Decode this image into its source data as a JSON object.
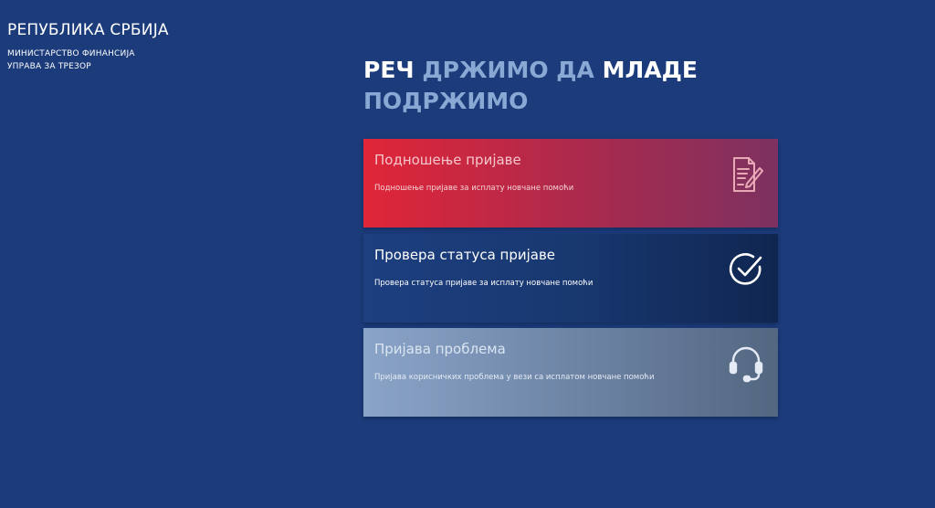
{
  "brand": {
    "country": "РЕПУБЛИКА СРБИЈА",
    "ministry": "МИНИСТАРСТВО ФИНАНСИЈА",
    "department": "УПРАВА ЗА ТРЕЗОР"
  },
  "headline": {
    "part1": "РЕЧ",
    "part2": "ДРЖИМО ДА",
    "part3": "МЛАДЕ",
    "part4": "ПОДРЖИМО"
  },
  "cards": [
    {
      "title": "Подношење пријаве",
      "description": "Подношење пријаве за исплату новчане помоћи",
      "icon": "document-edit-icon"
    },
    {
      "title": "Провера статуса пријаве",
      "description": "Провера статуса пријаве за исплату новчане помоћи",
      "icon": "check-circle-icon"
    },
    {
      "title": "Пријава проблема",
      "description": "Пријава корисничких проблема у вези са исплатом новчане помоћи",
      "icon": "headset-icon"
    }
  ],
  "colors": {
    "background": "#1b3b7a",
    "headline_accent": "#8aa8d4",
    "submit_start": "#e02638",
    "submit_end": "#7d3160",
    "status_start": "#1d3f7f",
    "status_end": "#102651",
    "problem_start": "#8aa4c8",
    "problem_end": "#536781"
  }
}
